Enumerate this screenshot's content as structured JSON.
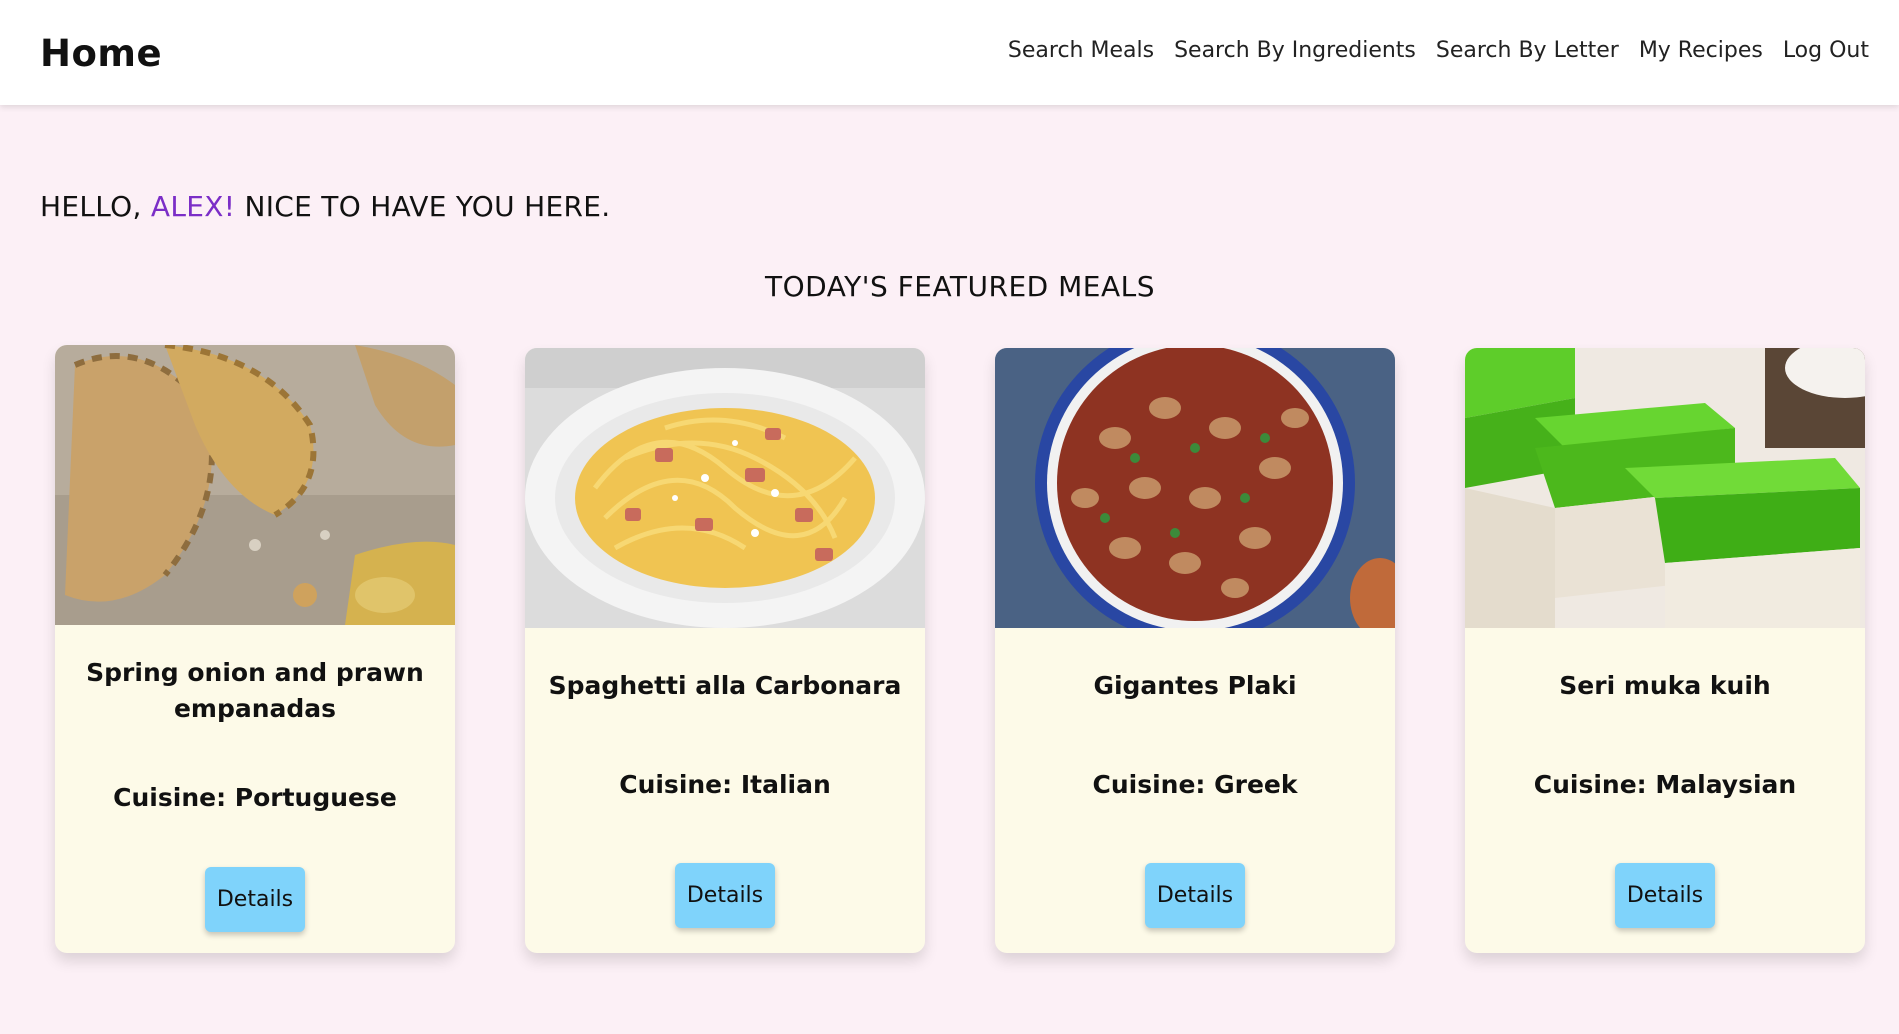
{
  "header": {
    "brand": "Home",
    "nav": [
      {
        "label": "Search Meals"
      },
      {
        "label": "Search By Ingredients"
      },
      {
        "label": "Search By Letter"
      },
      {
        "label": "My Recipes"
      },
      {
        "label": "Log Out"
      }
    ]
  },
  "greeting": {
    "prefix": "HELLO,",
    "name": "ALEX!",
    "suffix": "NICE TO HAVE YOU HERE."
  },
  "featured": {
    "title": "TODAY'S FEATURED MEALS",
    "meals": [
      {
        "name": "Spring onion and prawn empanadas",
        "cuisine": "Cuisine: Portuguese",
        "button": "Details"
      },
      {
        "name": "Spaghetti alla Carbonara",
        "cuisine": "Cuisine: Italian",
        "button": "Details"
      },
      {
        "name": "Gigantes Plaki",
        "cuisine": "Cuisine: Greek",
        "button": "Details"
      },
      {
        "name": "Seri muka kuih",
        "cuisine": "Cuisine: Malaysian",
        "button": "Details"
      }
    ]
  },
  "colors": {
    "page_background": "#fcf0f6",
    "card_background": "#fdfae8",
    "button_background": "#7fd3fb",
    "accent_name": "#7b2ec7"
  }
}
